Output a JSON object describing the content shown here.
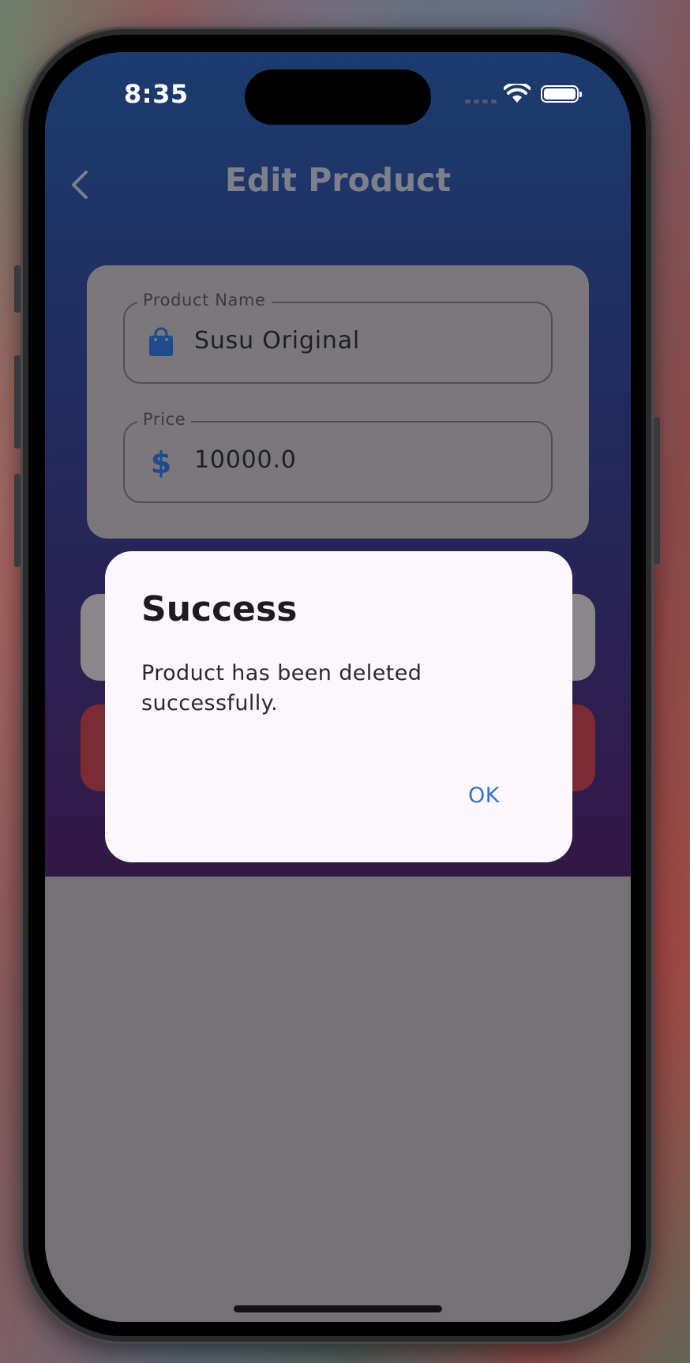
{
  "status_bar": {
    "time": "8:35"
  },
  "header": {
    "title": "Edit Product",
    "back_icon": "chevron-left-icon"
  },
  "form": {
    "product_name": {
      "label": "Product Name",
      "value": "Susu Original",
      "icon": "shopping-bag-icon"
    },
    "price": {
      "label": "Price",
      "value": "10000.0",
      "icon": "dollar-icon"
    }
  },
  "dialog": {
    "title": "Success",
    "message": "Product has been deleted successfully.",
    "ok_label": "OK"
  },
  "colors": {
    "gradient_top": "#1c3b6e",
    "gradient_bottom": "#331846",
    "delete_button": "#7c2a34",
    "accent_link": "#3a73c2",
    "icon_blue": "#1f4a8c"
  }
}
